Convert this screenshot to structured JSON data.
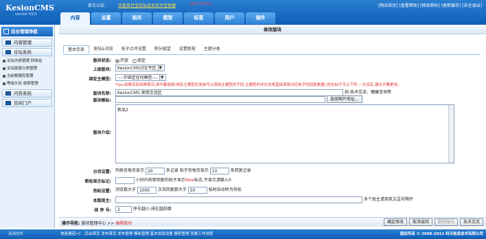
{
  "brand": {
    "name": "KesionCMS",
    "version": "version V9.0"
  },
  "notice": {
    "label": "官方公告:",
    "item1": "共享支付宝论坛会员",
    "item2": "支付宝快捷",
    "date": "2011-06-01"
  },
  "top_links": "[网站首页] [查看帮助] [修改密码] [更新缓存] [安全退出]",
  "tabs": [
    "内容",
    "设置",
    "相关",
    "模型",
    "标签",
    "用户",
    "插件"
  ],
  "sidebar": {
    "header": "后台管理导航",
    "sections": [
      {
        "label": "内容管理"
      },
      {
        "label": "论坛系统"
      }
    ],
    "sub_items": [
      "论坛内容管理  回收站",
      "论坛版面分类管理",
      "当前数据库管理",
      "等级头衔  勋章管理"
    ],
    "sections2": [
      {
        "label": "问答系统"
      },
      {
        "label": "空间门户"
      }
    ]
  },
  "page_title": "修改版块",
  "subtabs": [
    "基本信息",
    "发帖&浏览",
    "帖子点评设置",
    "积分威望",
    "设置新规",
    "主题分类"
  ],
  "form": {
    "status_label": "版块状态:",
    "status_on": "开放",
    "status_off": "锁定",
    "parent_label": "上级版块:",
    "parent_value": "KesionCMS讨论专区",
    "model_label": "绑定主模型:",
    "model_value": "----不绑定任何模型----",
    "tip": "Tips:如果没有特殊情况,请不要选择(绑定主模型后发帖可以调用主模型的字段,主模型的评论也将直接调用对应帖子的回复数据),但在帖子可以下阵,一旦设定,建议不要更改。",
    "name_label": "版块名称:",
    "name_value": "KesionCMS 使用交流区",
    "name_hint": "如:技术交流、健康咨询等",
    "icon_label": "版块图标:",
    "icon_button": "选择图片地址...",
    "intro_label": "版块介绍:",
    "intro_value": "新品2",
    "page_label": "分页设置:",
    "page_text1": "列表页每页显示",
    "page_val1": "20",
    "page_text2": "条记录 帖子页每页显示",
    "page_val2": "10",
    "page_text3": "条回复记录",
    "new_label": "新帖显示标记:",
    "new_text1": "小时内有新回复的帖子显示",
    "new_red": "New",
    "new_text2": "标志,不显示请输入0",
    "hot_label": "热帖设置:",
    "hot_text1": "浏览数大于",
    "hot_val1": "1000",
    "hot_text2": "次且回复数大于",
    "hot_val2": "50",
    "hot_text3": "帖时自动转为热帖",
    "master_label": "本版斑主:",
    "master_hint": "多个斑主请用英文逗号隔开",
    "order_label": "排 序 号:",
    "order_value": "2",
    "order_hint": "序号越小,排在越前面"
  },
  "breadcrumb": {
    "prefix": "操作导航:",
    "root": "版块管理中心",
    "sep": ">>",
    "current": "编辑版块"
  },
  "actions": [
    "确定修改",
    "取消返回",
    "删除版块",
    "技术交流"
  ],
  "footer": {
    "left": "关闭左栏",
    "links": "快速通道=》: 后台首页  发布首页  发布管理  模板管理  基本信息设置  模型管理  查看工作进度",
    "copy": "版权所有 © 2006-2012 科汛信息技术有限公司"
  }
}
